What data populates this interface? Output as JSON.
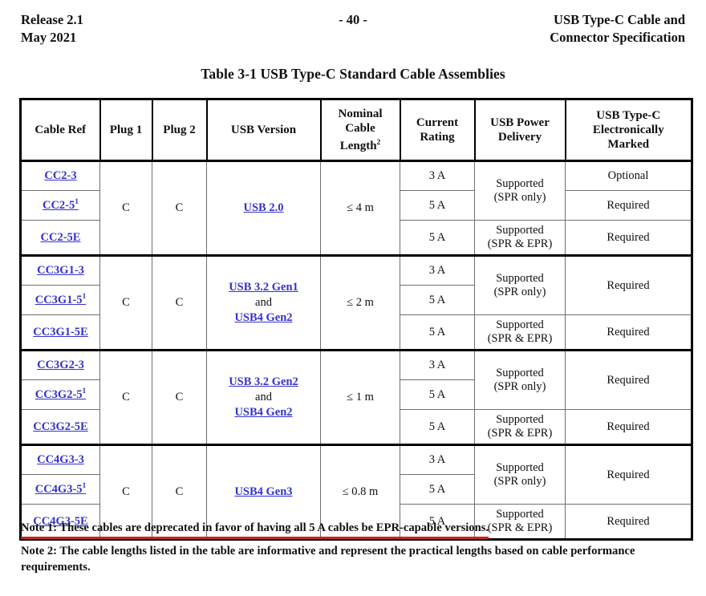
{
  "header": {
    "left_line1": "Release 2.1",
    "left_line2": "May 2021",
    "center": "- 40 -",
    "right_line1": "USB Type-C Cable and",
    "right_line2": "Connector Specification"
  },
  "caption": "Table 3-1  USB Type-C Standard Cable Assemblies",
  "colors": {
    "link": "#3333cc",
    "note_underline": "#cc2222",
    "text": "#101010",
    "border_heavy": "#000000",
    "border_light": "#6f6f6f"
  },
  "table": {
    "columns": [
      "Cable Ref",
      "Plug 1",
      "Plug 2",
      "USB Version",
      "Nominal Cable Length",
      "Current Rating",
      "USB Power Delivery",
      "USB Type-C Electronically Marked"
    ],
    "column_headers": {
      "cable_ref": "Cable Ref",
      "plug1": "Plug 1",
      "plug2": "Plug 2",
      "usb_version": "USB Version",
      "length_l1": "Nominal",
      "length_l2": "Cable",
      "length_l3": "Length",
      "length_sup": "2",
      "current_l1": "Current",
      "current_l2": "Rating",
      "pd_l1": "USB Power",
      "pd_l2": "Delivery",
      "em_l1": "USB Type-C",
      "em_l2": "Electronically",
      "em_l3": "Marked"
    },
    "groups": [
      {
        "cable_refs": [
          "CC2-3",
          "CC2-5",
          "CC2-5E"
        ],
        "cable_ref_sup": [
          "",
          "1",
          ""
        ],
        "plug1": "C",
        "plug2": "C",
        "usb_version_lines": [
          "USB 2.0"
        ],
        "length": "≤ 4 m",
        "current": [
          "3 A",
          "5 A",
          "5 A"
        ],
        "power_delivery": [
          "Supported (SPR only)",
          "Supported (SPR & EPR)"
        ],
        "pd_line1": [
          "Supported",
          "Supported"
        ],
        "pd_line2": [
          "(SPR only)",
          "(SPR & EPR)"
        ],
        "electronically_marked": [
          "Optional",
          "Required",
          "Required"
        ],
        "em_merge_first_two": false
      },
      {
        "cable_refs": [
          "CC3G1-3",
          "CC3G1-5",
          "CC3G1-5E"
        ],
        "cable_ref_sup": [
          "",
          "1",
          ""
        ],
        "plug1": "C",
        "plug2": "C",
        "usb_version_lines": [
          "USB 3.2 Gen1",
          "and",
          "USB4 Gen2"
        ],
        "length": "≤ 2 m",
        "current": [
          "3 A",
          "5 A",
          "5 A"
        ],
        "power_delivery": [
          "Supported (SPR only)",
          "Supported (SPR & EPR)"
        ],
        "pd_line1": [
          "Supported",
          "Supported"
        ],
        "pd_line2": [
          "(SPR only)",
          "(SPR & EPR)"
        ],
        "electronically_marked": [
          "Required",
          "Required"
        ],
        "em_merge_first_two": true
      },
      {
        "cable_refs": [
          "CC3G2-3",
          "CC3G2-5",
          "CC3G2-5E"
        ],
        "cable_ref_sup": [
          "",
          "1",
          ""
        ],
        "plug1": "C",
        "plug2": "C",
        "usb_version_lines": [
          "USB 3.2 Gen2",
          "and",
          "USB4 Gen2"
        ],
        "length": "≤ 1 m",
        "current": [
          "3 A",
          "5 A",
          "5 A"
        ],
        "power_delivery": [
          "Supported (SPR only)",
          "Supported (SPR & EPR)"
        ],
        "pd_line1": [
          "Supported",
          "Supported"
        ],
        "pd_line2": [
          "(SPR only)",
          "(SPR & EPR)"
        ],
        "electronically_marked": [
          "Required",
          "Required"
        ],
        "em_merge_first_two": true
      },
      {
        "cable_refs": [
          "CC4G3-3",
          "CC4G3-5",
          "CC4G3-5E"
        ],
        "cable_ref_sup": [
          "",
          "1",
          ""
        ],
        "plug1": "C",
        "plug2": "C",
        "usb_version_lines": [
          "USB4 Gen3"
        ],
        "length": "≤ 0.8 m",
        "current": [
          "3 A",
          "5 A",
          "5 A"
        ],
        "power_delivery": [
          "Supported (SPR only)",
          "Supported (SPR & EPR)"
        ],
        "pd_line1": [
          "Supported",
          "Supported"
        ],
        "pd_line2": [
          "(SPR only)",
          "(SPR & EPR)"
        ],
        "electronically_marked": [
          "Required",
          "Required"
        ],
        "em_merge_first_two": true
      }
    ]
  },
  "notes": {
    "note1": "Note 1: These cables are deprecated in favor of having all 5 A cables be EPR-capable versions.",
    "note2": "Note 2: The cable lengths listed in the table are informative and represent the practical lengths based on cable performance requirements."
  }
}
